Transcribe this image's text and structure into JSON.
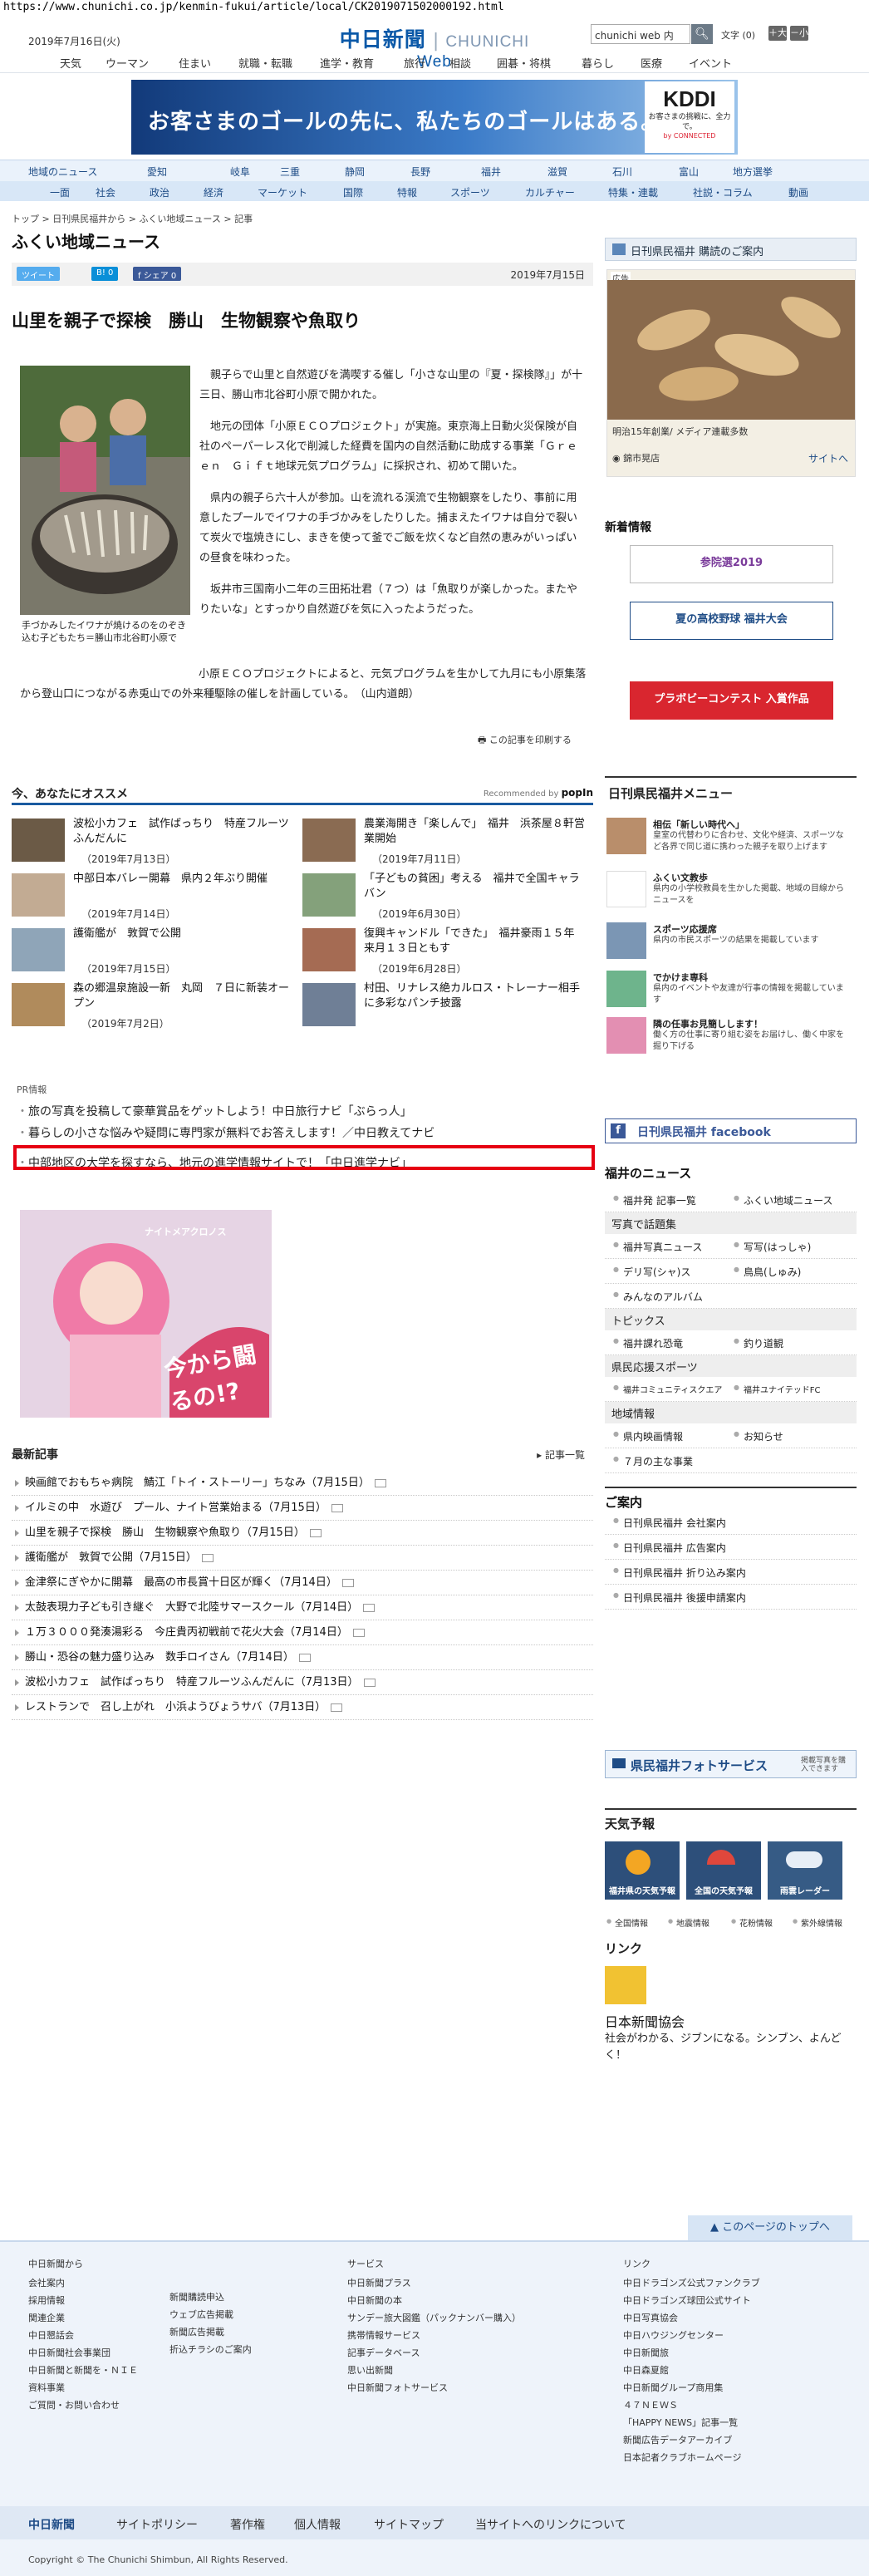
{
  "url": "https://www.chunichi.co.jp/kenmin-fukui/article/local/CK2019071502000192.html",
  "header": {
    "date": "2019年7月16日(火)",
    "logo_jp": "中日新聞",
    "logo_en": "CHUNICHI",
    "logo_web": "Web",
    "search_placeholder": "chunichi web 内",
    "search_icon": "search-icon",
    "font_size_label": "文字",
    "font_size_value": "(0)",
    "font_plus": "＋大",
    "font_minus": "－小",
    "nav": [
      "天気",
      "ウーマン",
      "住まい",
      "就職・転職",
      "進学・教育",
      "旅行",
      "相談",
      "囲碁・将棋",
      "暮らし",
      "医療",
      "イベント"
    ]
  },
  "top_ad": {
    "copy": "お客さまのゴールの先に、私たちのゴールはある。",
    "brand": "KDDI",
    "sub": "お客さまの挑戦に、全力で。",
    "sub2": "by CONNECTED"
  },
  "nav2": {
    "row1": [
      "地域のニュース",
      "愛知",
      "岐阜",
      "三重",
      "静岡",
      "長野",
      "福井",
      "滋賀",
      "石川",
      "富山",
      "地方選挙"
    ],
    "row2": [
      "一面",
      "社会",
      "政治",
      "経済",
      "マーケット",
      "国際",
      "特報",
      "スポーツ",
      "カルチャー",
      "特集・連載",
      "社説・コラム",
      "動画"
    ]
  },
  "breadcrumb": "トップ > 日刊県民福井から > ふくい地域ニュース > 記事",
  "section_title": "ふくい地域ニュース",
  "share": {
    "tweet": "ツイート",
    "hatena": "B! 0",
    "fb": "f シェア 0",
    "date": "2019年7月15日"
  },
  "headline": "山里を親子で探検　勝山　生物観察や魚取り",
  "photo_caption": "手づかみしたイワナが焼けるのをのぞき込む子どもたち＝勝山市北谷町小原で",
  "body": [
    "親子らで山里と自然遊びを満喫する催し「小さな山里の『夏・探検隊』」が十三日、勝山市北谷町小原で開かれた。",
    "地元の団体「小原ＥＣＯプロジェクト」が実施。東京海上日動火災保険が自社のペーパーレス化で削減した経費を国内の自然活動に助成する事業「Ｇｒｅｅｎ　Ｇｉｆｔ地球元気プログラム」に採択され、初めて開いた。",
    "県内の親子ら六十人が参加。山を流れる渓流で生物観察をしたり、事前に用意したプールでイワナの手づかみをしたりした。捕まえたイワナは自分で裂いて炭火で塩焼きにし、まきを使って釜でご飯を炊くなど自然の恵みがいっぱいの昼食を味わった。",
    "坂井市三国南小二年の三田拓壮君（７つ）は「魚取りが楽しかった。またやりたいな」とすっかり自然遊びを気に入ったようだった。"
  ],
  "body_tail": "小原ＥＣＯプロジェクトによると、元気プログラムを生かして九月にも小原集落から登山口につながる赤兎山での外来種駆除の催しを計画している。　（山内道朗）",
  "print_link": "この記事を印刷する",
  "recommend": {
    "title": "今、あなたにオススメ",
    "by": "Recommended by",
    "by_brand": "popIn",
    "items": [
      {
        "title": "波松小カフェ　試作ばっちり　特産フルーツふんだんに",
        "date": "（2019年7月13日）"
      },
      {
        "title": "農業海開き「楽しんで」　福井　浜茶屋８軒営業開始",
        "date": "（2019年7月11日）"
      },
      {
        "title": "中部日本バレー開幕　県内２年ぶり開催",
        "date": "（2019年7月14日）"
      },
      {
        "title": "「子どもの貧困」考える　福井で全国キャラバン",
        "date": "（2019年6月30日）"
      },
      {
        "title": "護衛艦が　敦賀で公開",
        "date": "（2019年7月15日）"
      },
      {
        "title": "復興キャンドル「できた」　福井豪雨１５年　来月１３日ともす",
        "date": "（2019年6月28日）"
      },
      {
        "title": "森の郷温泉施設一新　丸岡　７日に新装オープン",
        "date": "（2019年7月2日）"
      },
      {
        "title": "村田、リナレス絶カルロス・トレーナー相手に多彩なパンチ披露",
        "date": ""
      }
    ]
  },
  "pr": {
    "label": "PR情報",
    "lines": [
      "旅の写真を投稿して豪華賞品をゲットしよう！中日旅行ナビ「ぶらっ人」",
      "暮らしの小さな悩みや疑問に専門家が無料でお答えします！／中日教えてナビ",
      "中部地区の大学を探すなら、地元の進学情報サイトで！「中日進学ナビ」"
    ]
  },
  "game_ad": {
    "logo": "ナイトメアクロノス",
    "copy": "今から闘るの!?"
  },
  "latest": {
    "title": "最新記事",
    "all": "記事一覧",
    "items": [
      "映画館でおもちゃ病院　鯖江「トイ・ストーリー」ちなみ（7月15日）",
      "イルミの中　水遊び　プール、ナイト営業始まる（7月15日）",
      "山里を親子で探検　勝山　生物観察や魚取り（7月15日）",
      "護衛艦が　敦賀で公開（7月15日）",
      "金津祭にぎやかに開幕　最高の市長賞十日区が輝く（7月14日）",
      "太鼓表現力子ども引き継ぐ　大野で北陸サマースクール（7月14日）",
      "１万３０００発湊湯彩る　今庄貴丙初戦前で花火大会（7月14日）",
      "勝山・恐谷の魅力盛り込み　数手ロイさん（7月14日）",
      "波松小カフェ　試作ばっちり　特産フルーツふんだんに（7月13日）",
      "レストランで　召し上がれ　小浜ようびょうサバ（7月13日）"
    ]
  },
  "sidebar": {
    "subscribe": "日刊県民福井 購読のご案内",
    "ad_caption": "明治15年創業/ メディア連載多数",
    "ad_shop": "錦市晃店",
    "ad_site": "サイトへ",
    "ad_label": "広告",
    "new_info": "新着情報",
    "sanin": "参院選2019",
    "koshien": "夏の高校野球 福井大会",
    "plamo": "プラボビーコンテスト 入賞作品",
    "menu_title": "日刊県民福井メニュー",
    "menu": [
      {
        "title": "相伝「新しい時代へ」",
        "desc": "皇室の代替わりに合わせ、文化や経済、スポーツなど各界で同じ道に携わった親子を取り上げます"
      },
      {
        "title": "ふくい文教歩",
        "desc": "県内の小学校教員を生かした掲載、地域の目線からニュースを"
      },
      {
        "title": "スポーツ応援席",
        "desc": "県内の市民スポーツの結果を掲載しています"
      },
      {
        "title": "でかけま専科",
        "desc": "県内のイベントや友達が行事の情報を掲載しています"
      },
      {
        "title": "隣の任事お見簡しします！",
        "desc": "働く方の仕事に寄り組む姿をお届けし、働く中家を掘り下げる"
      }
    ],
    "fb": "日刊県民福井 facebook",
    "news_title": "福井のニュース",
    "news_rows": [
      [
        "福井発 記事一覧",
        "ふくい地域ニュース"
      ],
      [
        "写真で話題集"
      ],
      [
        "福井写真ニュース",
        "写写(はっしゃ)"
      ],
      [
        "デリ写(シャ)ス",
        "鳥鳥(しゅみ)"
      ],
      [
        "みんなのアルバム"
      ],
      [
        "トピックス"
      ],
      [
        "福井課れ恐竜",
        "釣り道観"
      ],
      [
        "県民応援スポーツ"
      ],
      [
        "福井コミュニティスクエア",
        "福井ユナイテッドFC"
      ],
      [
        "地域情報"
      ],
      [
        "県内映画情報",
        "お知らせ"
      ],
      [
        "７月の主な事業"
      ]
    ],
    "guide_title": "ご案内",
    "guide": [
      [
        "日刊県民福井 会社案内",
        "日刊県民福井 広告案内",
        "日刊県民福井 折り込み案内",
        "日刊県民福井 後援申請案内"
      ]
    ],
    "photo_service": "県民福井フォトサービス",
    "photo_service_sub": "掲載写真を購入できます",
    "weather_title": "天気予報",
    "weather_tiles": [
      "福井県の天気予報",
      "全国の天気予報",
      "雨雲レーダー"
    ],
    "weather_links": [
      "全国情報",
      "地震情報",
      "花粉情報",
      "紫外線情報"
    ],
    "link_title": "リンク",
    "link_name": "日本新聞協会",
    "link_desc": "社会がわかる、ジブンになる。シンブン、よんどく！"
  },
  "back_top": "このページのトップへ",
  "footer": {
    "col1_title": "中日新聞から",
    "col1": [
      "会社案内",
      "採用情報",
      "関連企業",
      "中日懇話会",
      "中日新聞社会事業団",
      "中日新聞と新聞を・ＮＩＥ",
      "資料事業",
      "ご質問・お問い合わせ"
    ],
    "col2": [
      "新聞購読申込",
      "ウェブ広告掲載",
      "新聞広告掲載",
      "折込チラシのご案内"
    ],
    "col3_title": "サービス",
    "col3": [
      "中日新聞プラス",
      "中日新聞の本",
      "サンデー旅大図鑑（パックナンバー購入）",
      "携帯情報サービス",
      "記事データベース",
      "思い出新聞",
      "中日新聞フォトサービス"
    ],
    "col4_title": "リンク",
    "col4": [
      "中日ドラゴンズ公式ファンクラブ",
      "中日ドラゴンズ球団公式サイト",
      "中日写真協会",
      "中日ハウジングセンター",
      "中日新聞旅",
      "中日森夏館",
      "中日新聞グループ商用集",
      "４７ＮＥＷＳ",
      "「HAPPY NEWS」記事一覧",
      "新聞広告データアーカイブ",
      "日本記者クラブホームページ"
    ],
    "bottom": [
      "中日新聞",
      "サイトポリシー",
      "著作権",
      "個人情報",
      "サイトマップ",
      "当サイトへのリンクについて"
    ],
    "copyright": "Copyright © The Chunichi Shimbun, All Rights Reserved."
  }
}
